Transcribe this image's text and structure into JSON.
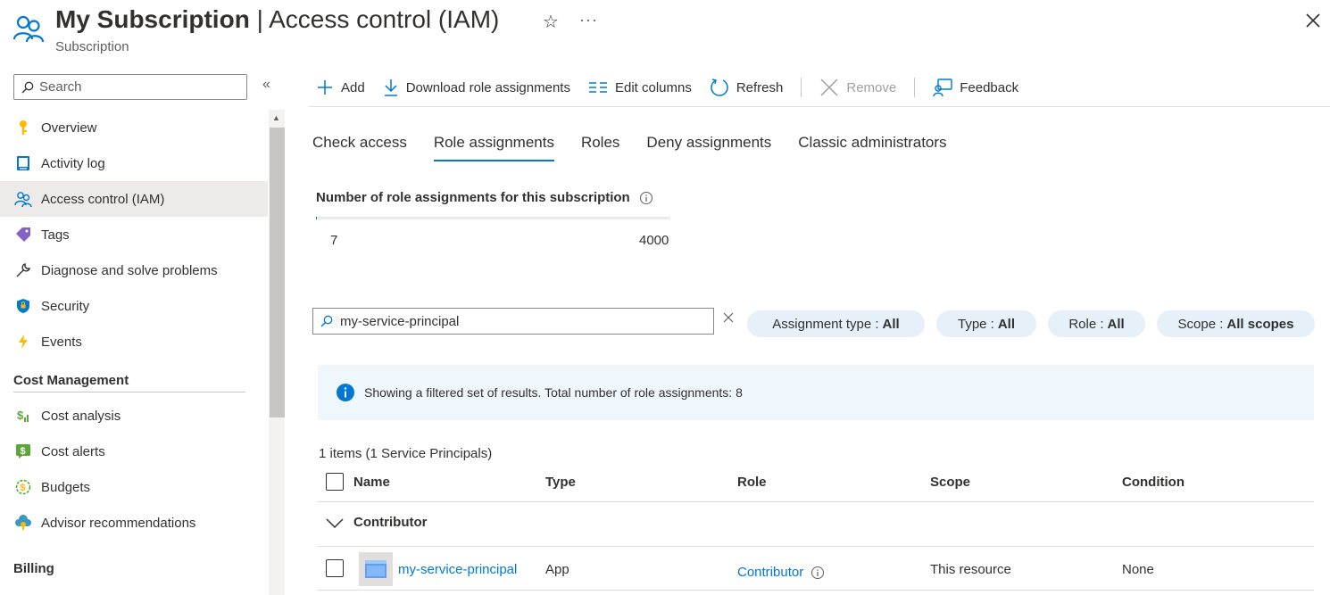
{
  "header": {
    "title_strong": "My Subscription",
    "title_rest": " | Access control (IAM)",
    "subtitle": "Subscription",
    "star_glyph": "☆",
    "more_glyph": "···"
  },
  "sidebar": {
    "search_placeholder": "Search",
    "collapse_glyph": "«",
    "items": [
      {
        "label": "Overview",
        "icon": "key-icon"
      },
      {
        "label": "Activity log",
        "icon": "log-icon"
      },
      {
        "label": "Access control (IAM)",
        "icon": "people-icon",
        "active": true
      },
      {
        "label": "Tags",
        "icon": "tag-icon"
      },
      {
        "label": "Diagnose and solve problems",
        "icon": "wrench-icon"
      },
      {
        "label": "Security",
        "icon": "shield-icon"
      },
      {
        "label": "Events",
        "icon": "lightning-icon"
      }
    ],
    "sections": [
      {
        "title": "Cost Management",
        "items": [
          {
            "label": "Cost analysis",
            "icon": "cost-analysis-icon"
          },
          {
            "label": "Cost alerts",
            "icon": "cost-alert-icon"
          },
          {
            "label": "Budgets",
            "icon": "budget-icon"
          },
          {
            "label": "Advisor recommendations",
            "icon": "advisor-icon"
          }
        ]
      },
      {
        "title": "Billing"
      }
    ]
  },
  "toolbar": {
    "add": "Add",
    "download": "Download role assignments",
    "edit_columns": "Edit columns",
    "refresh": "Refresh",
    "remove": "Remove",
    "feedback": "Feedback"
  },
  "tabs": [
    {
      "label": "Check access"
    },
    {
      "label": "Role assignments",
      "active": true
    },
    {
      "label": "Roles"
    },
    {
      "label": "Deny assignments"
    },
    {
      "label": "Classic administrators"
    }
  ],
  "count": {
    "label": "Number of role assignments for this subscription",
    "current": "7",
    "max": "4000",
    "fraction": 0.00175
  },
  "filter": {
    "value": "my-service-principal",
    "pills": [
      {
        "label": "Assignment type :",
        "value": "All"
      },
      {
        "label": "Type :",
        "value": "All"
      },
      {
        "label": "Role :",
        "value": "All"
      },
      {
        "label": "Scope :",
        "value": "All scopes"
      }
    ]
  },
  "banner": {
    "text": "Showing a filtered set of results. Total number of role assignments: 8"
  },
  "table": {
    "items_count": "1 items (1 Service Principals)",
    "columns": [
      "Name",
      "Type",
      "Role",
      "Scope",
      "Condition"
    ],
    "group": "Contributor",
    "rows": [
      {
        "name": "my-service-principal",
        "type": "App",
        "role": "Contributor",
        "scope": "This resource",
        "condition": "None"
      }
    ]
  },
  "colors": {
    "accent": "#0078d4",
    "pill_bg": "#e6f0f9",
    "banner_bg": "#eff6fc"
  }
}
